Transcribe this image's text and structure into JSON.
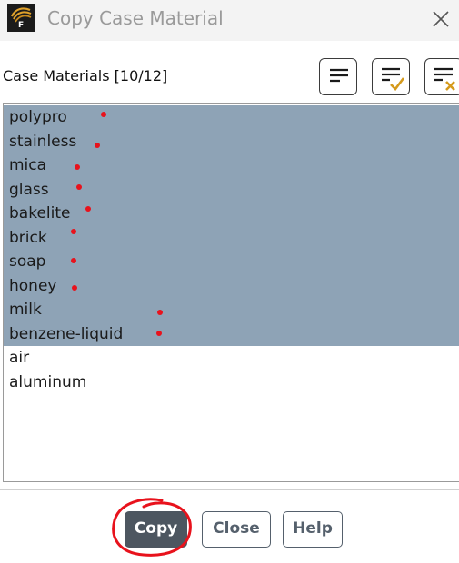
{
  "window": {
    "title": "Copy Case Material",
    "icon_letter": "F",
    "close_icon": "close-icon"
  },
  "list": {
    "label": "Case Materials  [10/12]",
    "items": [
      {
        "name": "polypro",
        "selected": true
      },
      {
        "name": "stainless",
        "selected": true
      },
      {
        "name": "mica",
        "selected": true
      },
      {
        "name": "glass",
        "selected": true
      },
      {
        "name": "bakelite",
        "selected": true
      },
      {
        "name": "brick",
        "selected": true
      },
      {
        "name": "soap",
        "selected": true
      },
      {
        "name": "honey",
        "selected": true
      },
      {
        "name": "milk",
        "selected": true
      },
      {
        "name": "benzene-liquid",
        "selected": true
      },
      {
        "name": "air",
        "selected": false
      },
      {
        "name": "aluminum",
        "selected": false
      }
    ],
    "selected_color": "#8ea3b6"
  },
  "toolbar": {
    "buttons": [
      {
        "icon": "lines-icon"
      },
      {
        "icon": "select-all-icon"
      },
      {
        "icon": "deselect-all-icon"
      }
    ],
    "accent": "#d59a1c"
  },
  "buttons": {
    "copy": "Copy",
    "close": "Close",
    "help": "Help"
  },
  "annotations": {
    "marker_color": "#e8121c"
  }
}
